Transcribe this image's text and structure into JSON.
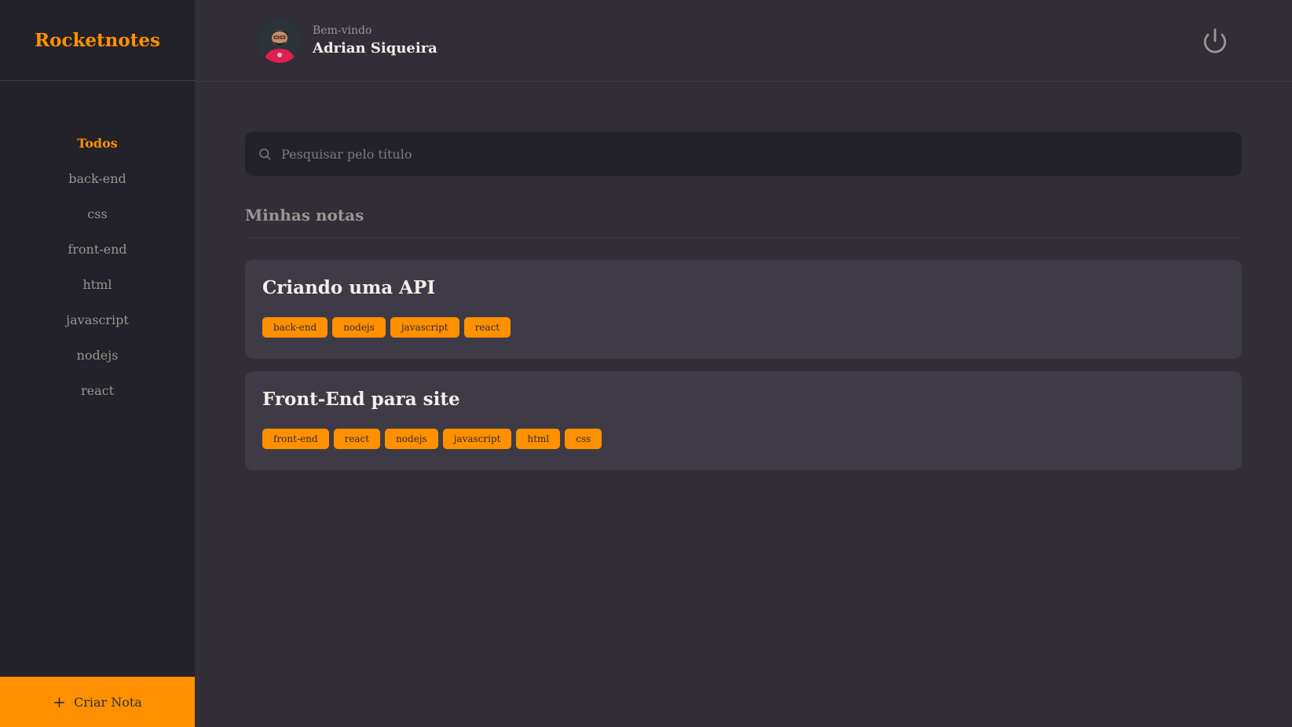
{
  "brand": {
    "title": "Rocketnotes"
  },
  "sidebar": {
    "items": [
      {
        "label": "Todos"
      },
      {
        "label": "back-end"
      },
      {
        "label": "css"
      },
      {
        "label": "front-end"
      },
      {
        "label": "html"
      },
      {
        "label": "javascript"
      },
      {
        "label": "nodejs"
      },
      {
        "label": "react"
      }
    ],
    "new_note_label": "Criar Nota"
  },
  "header": {
    "welcome": "Bem-vindo",
    "user_name": "Adrian Siqueira"
  },
  "search": {
    "placeholder": "Pesquisar pelo título"
  },
  "section": {
    "title": "Minhas notas"
  },
  "notes": [
    {
      "title": "Criando uma API",
      "tags": [
        "back-end",
        "nodejs",
        "javascript",
        "react"
      ]
    },
    {
      "title": "Front-End para site",
      "tags": [
        "front-end",
        "react",
        "nodejs",
        "javascript",
        "html",
        "css"
      ]
    }
  ],
  "colors": {
    "accent": "#FF9000",
    "background": "#312E38",
    "sidebar": "#232129",
    "card": "#3E3B47"
  },
  "icons": {
    "search": "search-icon",
    "logout": "power-icon",
    "add": "plus-icon"
  }
}
